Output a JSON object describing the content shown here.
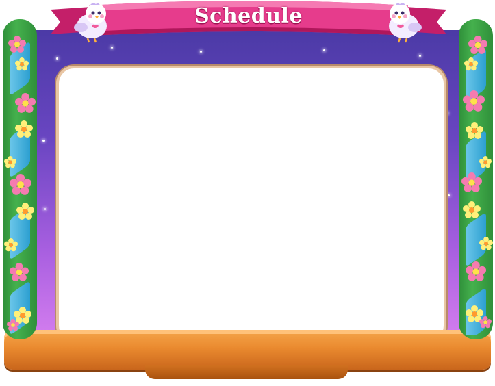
{
  "header": {
    "title": "Schedule"
  },
  "theme": {
    "sky_top": "#4b3aa6",
    "sky_bottom": "#d780f0",
    "banner_pink": "#e63c8c",
    "shelf_orange": "#ea8a2f",
    "vine_green": "#45b14d",
    "ribbon_blue": "#2b9fd8"
  },
  "decorations": {
    "left_bird": "bird-icon",
    "right_bird": "bird-icon",
    "flowers": "flower-icon"
  }
}
